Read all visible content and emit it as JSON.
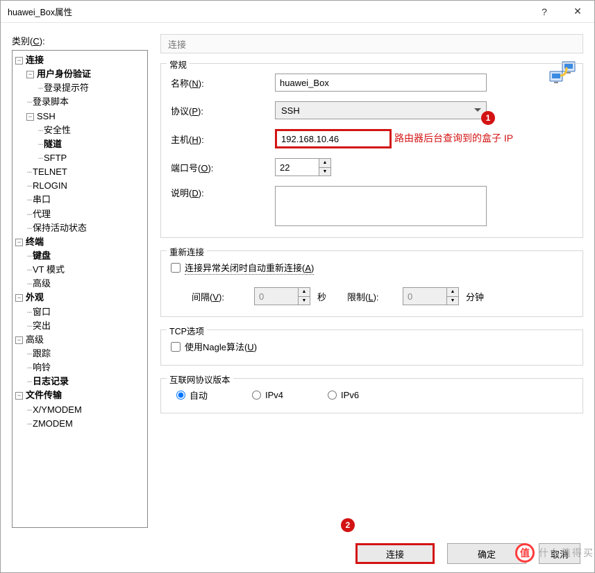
{
  "window": {
    "title": "huawei_Box属性",
    "help": "?",
    "close": "✕"
  },
  "category_label": "类别(C):",
  "tree": {
    "connection": "连接",
    "user_auth": "用户身份验证",
    "login_prompt": "登录提示符",
    "login_script": "登录脚本",
    "ssh": "SSH",
    "security": "安全性",
    "tunnel": "隧道",
    "sftp": "SFTP",
    "telnet": "TELNET",
    "rlogin": "RLOGIN",
    "serial": "串口",
    "proxy": "代理",
    "keepalive": "保持活动状态",
    "terminal": "终端",
    "keyboard": "键盘",
    "vtmode": "VT 模式",
    "advanced_term": "高级",
    "appearance": "外观",
    "window": "窗口",
    "highlight": "突出",
    "advanced": "高级",
    "trace": "跟踪",
    "bell": "响铃",
    "logging": "日志记录",
    "file_transfer": "文件传输",
    "xymodem": "X/YMODEM",
    "zmodem": "ZMODEM"
  },
  "crumb": "连接",
  "general": {
    "legend": "常规",
    "name_label_pre": "名称(",
    "name_label_u": "N",
    "name_label_post": "):",
    "name_value": "huawei_Box",
    "protocol_label_pre": "协议(",
    "protocol_label_u": "P",
    "protocol_label_post": "):",
    "protocol_value": "SSH",
    "host_label_pre": "主机(",
    "host_label_u": "H",
    "host_label_post": "):",
    "host_value": "192.168.10.46",
    "port_label_pre": "端口号(",
    "port_label_u": "O",
    "port_label_post": "):",
    "port_value": "22",
    "desc_label_pre": "说明(",
    "desc_label_u": "D",
    "desc_label_post": "):",
    "desc_value": ""
  },
  "reconnect": {
    "legend": "重新连接",
    "checkbox_pre": "连接异常关闭时自动重新连接(",
    "checkbox_u": "A",
    "checkbox_post": ")",
    "interval_pre": "间隔(",
    "interval_u": "V",
    "interval_post": "):",
    "interval_value": "0",
    "interval_unit": "秒",
    "limit_pre": "限制(",
    "limit_u": "L",
    "limit_post": "):",
    "limit_value": "0",
    "limit_unit": "分钟"
  },
  "tcp": {
    "legend": "TCP选项",
    "nagle_pre": "使用Nagle算法(",
    "nagle_u": "U",
    "nagle_post": ")"
  },
  "ipver": {
    "legend": "互联网协议版本",
    "auto": "自动",
    "ipv4": "IPv4",
    "ipv6": "IPv6"
  },
  "buttons": {
    "connect": "连接",
    "ok": "确定",
    "cancel": "取消"
  },
  "annotations": {
    "badge1": "1",
    "badge2": "2",
    "host_note": "路由器后台查询到的盒子 IP"
  },
  "branding": {
    "badge": "值",
    "text": "什么值得买"
  }
}
